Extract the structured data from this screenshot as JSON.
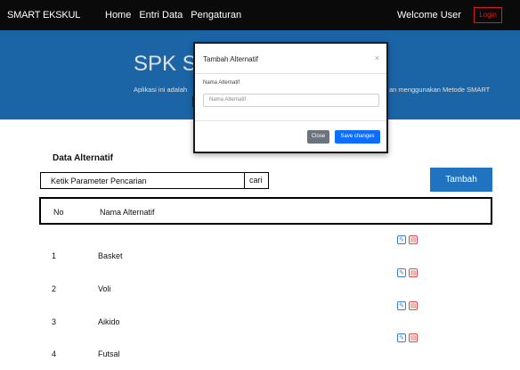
{
  "navbar": {
    "brand": "SMART EKSKUL",
    "links": [
      "Home",
      "Entri Data",
      "Pengaturan"
    ],
    "welcome": "Welcome User",
    "login": "Login"
  },
  "hero": {
    "title": "SPK SM",
    "subtitle_left": "Aplikasi ini adalah",
    "subtitle_right": "an menggunakan Metode SMART"
  },
  "modal": {
    "title": "Tambah Alternatif",
    "close_symbol": "×",
    "field_label": "Nama Alternatif",
    "field_placeholder": "Nama Alternatif",
    "close_label": "Close",
    "save_label": "Save changes"
  },
  "content": {
    "section_title": "Data Alternatif",
    "search_placeholder": "Ketik Parameter Pencarian",
    "search_button": "cari",
    "add_button": "Tambah"
  },
  "table": {
    "headers": [
      "No",
      "Nama Alternatif"
    ],
    "rows": [
      {
        "no": "1",
        "name": "Basket"
      },
      {
        "no": "2",
        "name": "Voli"
      },
      {
        "no": "3",
        "name": "Aikido"
      },
      {
        "no": "4",
        "name": "Futsal"
      }
    ]
  },
  "icons": {
    "edit": "pencil-icon",
    "delete": "trash-icon"
  },
  "colors": {
    "primary": "#1f73bf",
    "navbar": "#0a0a0a",
    "login_border": "#d31e1e",
    "save_button": "#0d6efd",
    "close_button": "#6c757d"
  }
}
